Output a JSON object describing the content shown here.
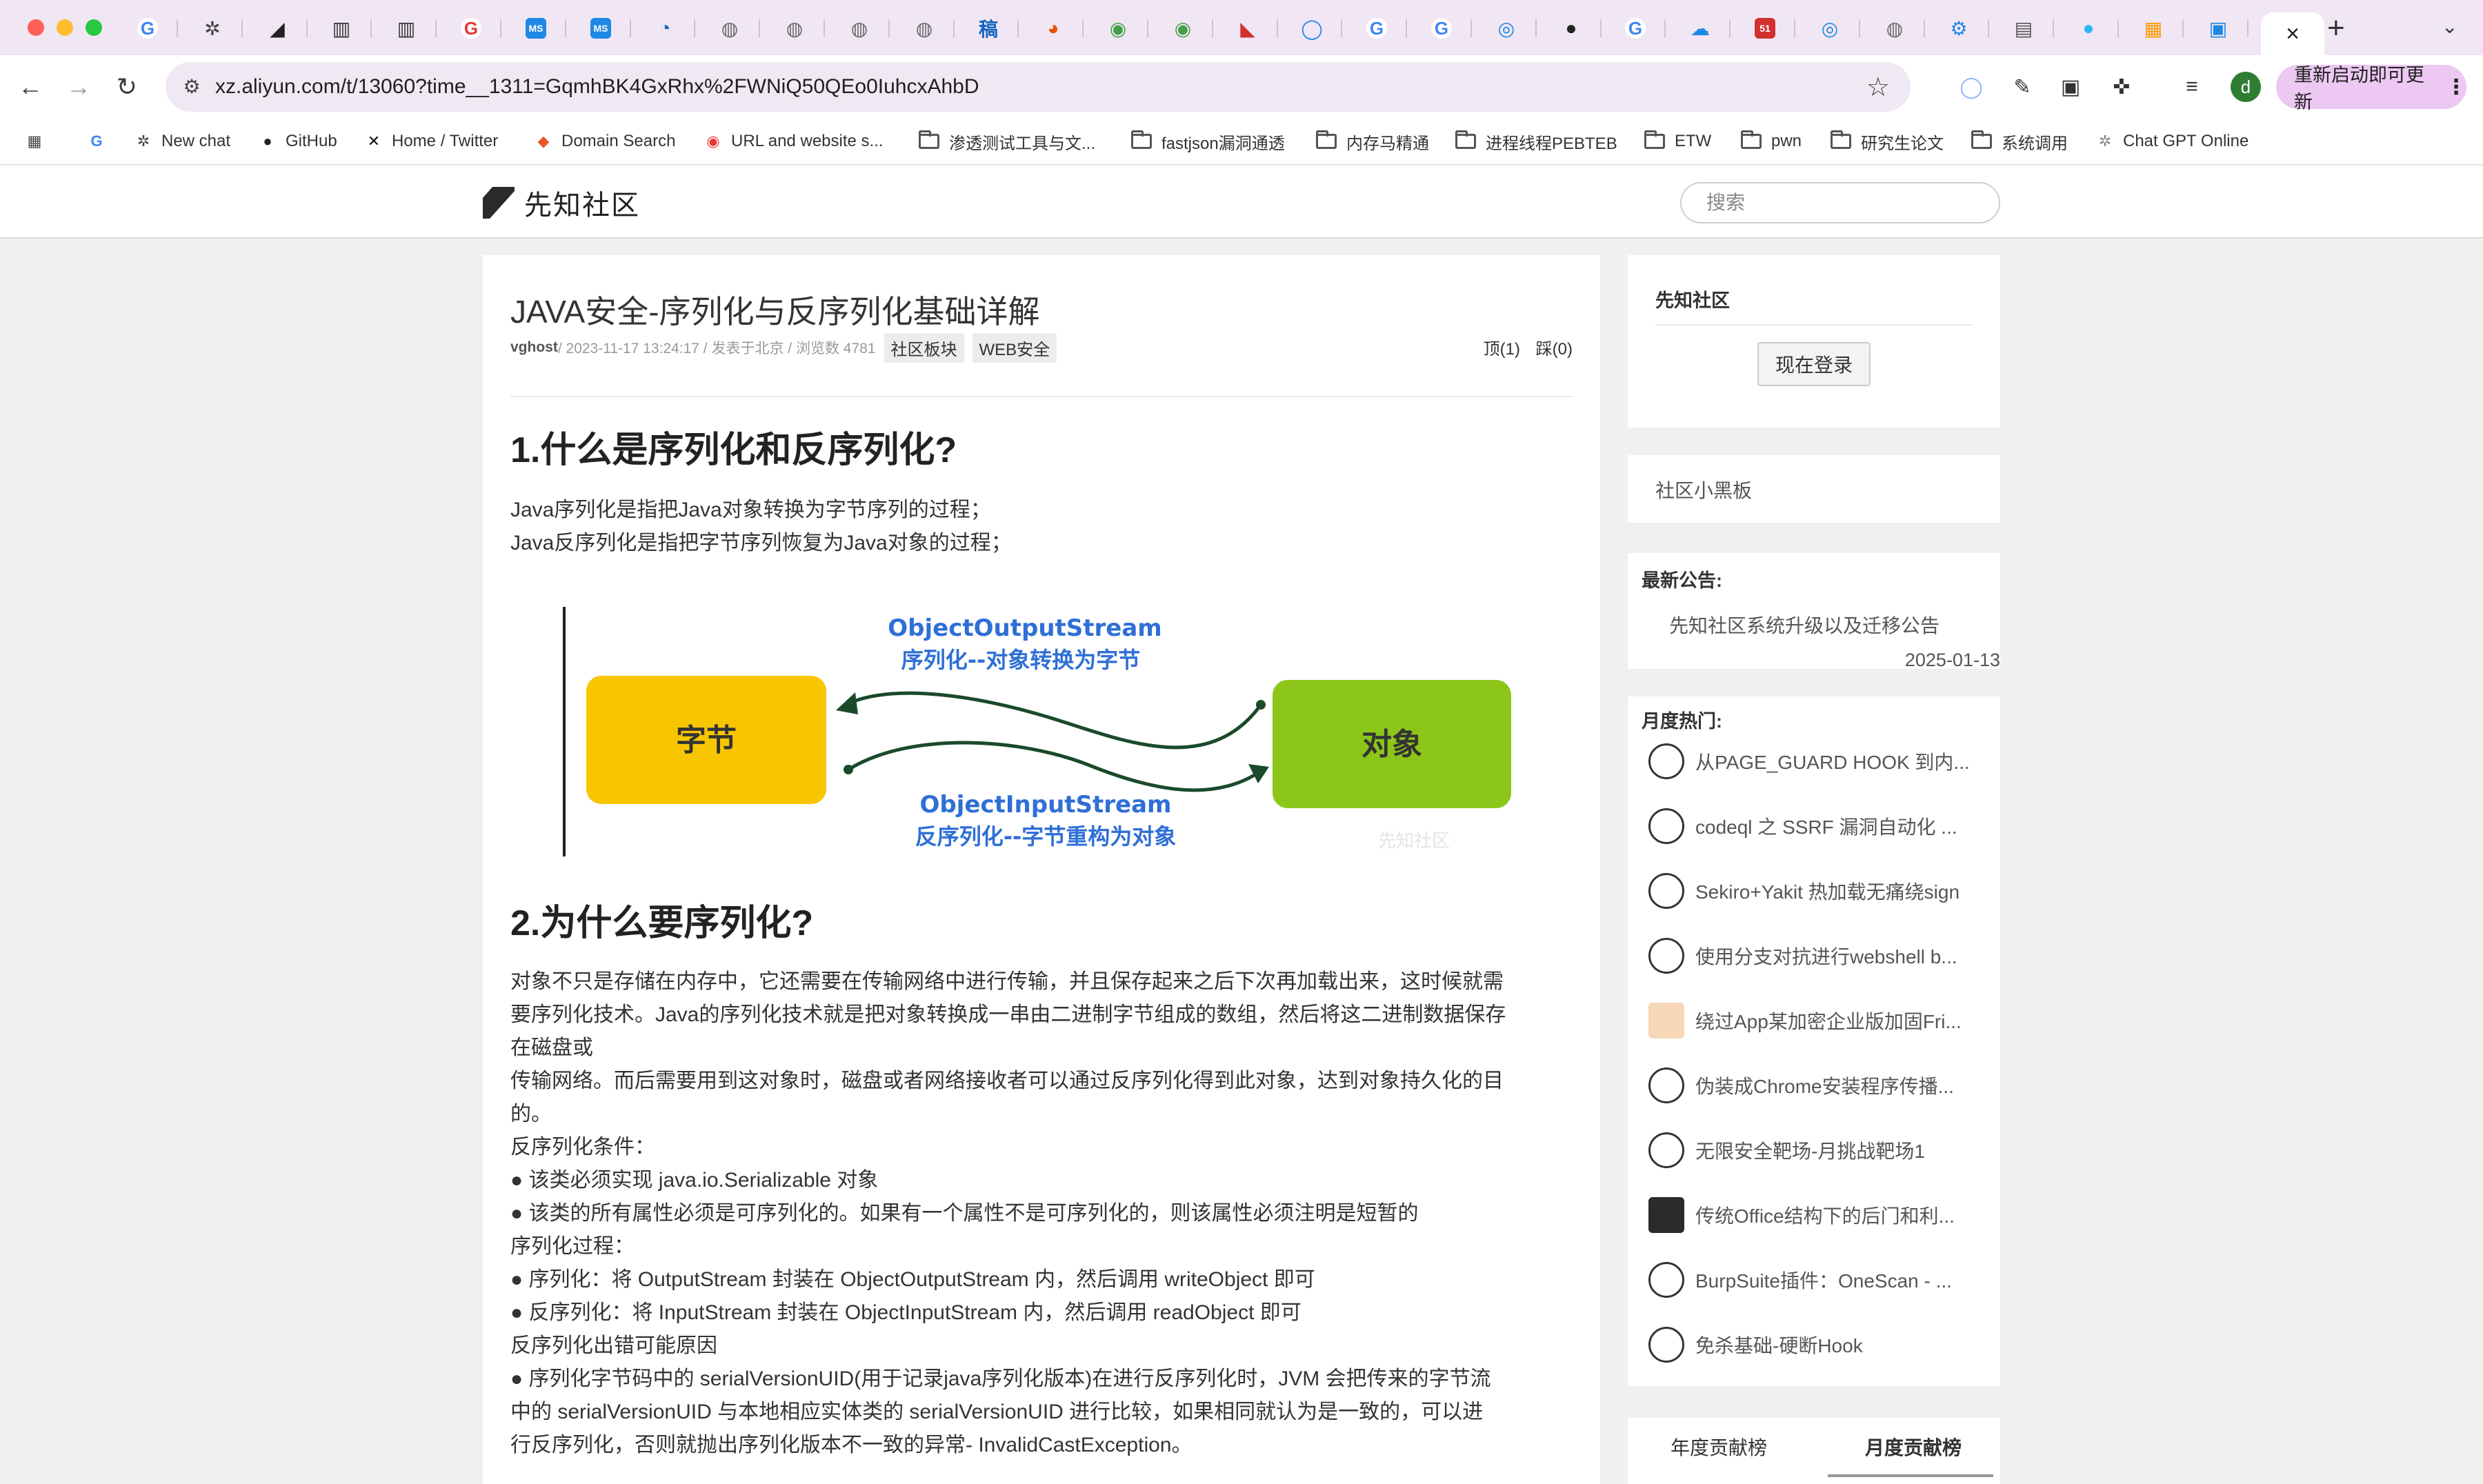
{
  "browser": {
    "tabs": [
      {
        "icon": "google-icon",
        "glyph": "G",
        "color": "#4285f4"
      },
      {
        "icon": "chatgpt-icon",
        "glyph": "✲",
        "color": "#444444"
      },
      {
        "icon": "xianzhi-icon",
        "glyph": "◢",
        "color": "#222222"
      },
      {
        "icon": "book-icon",
        "glyph": "▥",
        "color": "#333333"
      },
      {
        "icon": "book-icon",
        "glyph": "▥",
        "color": "#333333"
      },
      {
        "icon": "csdn-icon",
        "glyph": "G",
        "color": "#e53935"
      },
      {
        "icon": "msdn-icon",
        "glyph": "MS",
        "color": "#1e88e5"
      },
      {
        "icon": "msdn-icon",
        "glyph": "MS",
        "color": "#1e88e5"
      },
      {
        "icon": "search-icon",
        "glyph": "◔",
        "color": "#1565c0"
      },
      {
        "icon": "globe-icon",
        "glyph": "◍",
        "color": "#666666"
      },
      {
        "icon": "globe-icon",
        "glyph": "◍",
        "color": "#666666"
      },
      {
        "icon": "globe-icon",
        "glyph": "◍",
        "color": "#666666"
      },
      {
        "icon": "globe-icon",
        "glyph": "◍",
        "color": "#666666"
      },
      {
        "icon": "doc-icon",
        "glyph": "稿",
        "color": "#1565c0"
      },
      {
        "icon": "swirl-icon",
        "glyph": "◕",
        "color": "#e65100"
      },
      {
        "icon": "tools-icon",
        "glyph": "◉",
        "color": "#43a047"
      },
      {
        "icon": "tools-icon",
        "glyph": "◉",
        "color": "#43a047"
      },
      {
        "icon": "pdf-icon",
        "glyph": "◣",
        "color": "#d32f2f"
      },
      {
        "icon": "qq-icon",
        "glyph": "◯",
        "color": "#1e88e5"
      },
      {
        "icon": "google-icon",
        "glyph": "G",
        "color": "#4285f4"
      },
      {
        "icon": "google-icon",
        "glyph": "G",
        "color": "#4285f4"
      },
      {
        "icon": "blue-circle-icon",
        "glyph": "◎",
        "color": "#1e88e5"
      },
      {
        "icon": "github-icon",
        "glyph": "●",
        "color": "#222222"
      },
      {
        "icon": "google-icon",
        "glyph": "G",
        "color": "#4285f4"
      },
      {
        "icon": "cloud-icon",
        "glyph": "☁",
        "color": "#1e88e5"
      },
      {
        "icon": "51cto-icon",
        "glyph": "51",
        "color": "#d32f2f"
      },
      {
        "icon": "blue-circle-icon",
        "glyph": "◎",
        "color": "#1e88e5"
      },
      {
        "icon": "globe-icon",
        "glyph": "◍",
        "color": "#666666"
      },
      {
        "icon": "gear-icon",
        "glyph": "⚙",
        "color": "#1e88e5"
      },
      {
        "icon": "notes-icon",
        "glyph": "▤",
        "color": "#555555"
      },
      {
        "icon": "circle-icon",
        "glyph": "●",
        "color": "#29b6f6"
      },
      {
        "icon": "windows-icon",
        "glyph": "▦",
        "color": "#ff9800"
      },
      {
        "icon": "bilibili-icon",
        "glyph": "▣",
        "color": "#1e88e5"
      }
    ],
    "active_tab_close": "×",
    "new_tab": "+",
    "url": "xz.aliyun.com/t/13060?time__1311=GqmhBK4GxRhx%2FWNiQ50QEo0IuhcxAhbD",
    "update_button": "重新启动即可更新",
    "profile_initial": "d",
    "bookmarks": [
      {
        "label": "",
        "icon": "apps-grid-icon"
      },
      {
        "label": "",
        "icon": "google-icon"
      },
      {
        "label": "New chat",
        "icon": "chatgpt-icon"
      },
      {
        "label": "GitHub",
        "icon": "github-icon"
      },
      {
        "label": "Home / Twitter",
        "icon": "x-icon"
      },
      {
        "label": "Domain Search",
        "icon": "domain-icon"
      },
      {
        "label": "URL and website s...",
        "icon": "virustotal-icon"
      },
      {
        "label": "渗透测试工具与文...",
        "icon": "folder-icon"
      },
      {
        "label": "fastjson漏洞通透",
        "icon": "folder-icon"
      },
      {
        "label": "内存马精通",
        "icon": "folder-icon"
      },
      {
        "label": "进程线程PEBTEB",
        "icon": "folder-icon"
      },
      {
        "label": "ETW",
        "icon": "folder-icon"
      },
      {
        "label": "pwn",
        "icon": "folder-icon"
      },
      {
        "label": "研究生论文",
        "icon": "folder-icon"
      },
      {
        "label": "系统调用",
        "icon": "folder-icon"
      },
      {
        "label": "Chat GPT Online",
        "icon": "chatgpt-online-icon"
      }
    ]
  },
  "site": {
    "logo_text": "先知社区",
    "search_placeholder": "搜索"
  },
  "article": {
    "title": "JAVA安全-序列化与反序列化基础详解",
    "author": "vghost",
    "meta_rest": " / 2023-11-17 13:24:17 / 发表于北京 / 浏览数 4781",
    "tags": [
      "社区板块",
      "WEB安全"
    ],
    "upvote": "顶(1)",
    "downvote": "踩(0)",
    "h1": "1.什么是序列化和反序列化?",
    "intro": [
      "Java序列化是指把Java对象转换为字节序列的过程；",
      "Java反序列化是指把字节序列恢复为Java对象的过程；"
    ],
    "diagram": {
      "left_box": "字节",
      "right_box": "对象",
      "top_stream": "ObjectOutputStream",
      "top_desc": "序列化--对象转换为字节",
      "bottom_stream": "ObjectInputStream",
      "bottom_desc": "反序列化--字节重构为对象",
      "watermark": "先知社区"
    },
    "h2": "2.为什么要序列化?",
    "body": [
      "对象不只是存储在内存中，它还需要在传输网络中进行传输，并且保存起来之后下次再加载出来，这时候就需",
      "要序列化技术。Java的序列化技术就是把对象转换成一串由二进制字节组成的数组，然后将这二进制数据保存",
      "在磁盘或",
      "传输网络。而后需要用到这对象时，磁盘或者网络接收者可以通过反序列化得到此对象，达到对象持久化的目",
      "的。",
      "反序列化条件：",
      "● 该类必须实现 java.io.Serializable 对象",
      "● 该类的所有属性必须是可序列化的。如果有一个属性不是可序列化的，则该属性必须注明是短暂的",
      "序列化过程：",
      "● 序列化：将 OutputStream 封装在 ObjectOutputStream 内，然后调用 writeObject 即可",
      "● 反序列化：将 InputStream 封装在 ObjectInputStream 内，然后调用 readObject 即可",
      "反序列化出错可能原因",
      "● 序列化字节码中的 serialVersionUID(用于记录java序列化版本)在进行反序列化时，JVM 会把传来的字节流",
      "中的 serialVersionUID 与本地相应实体类的 serialVersionUID 进行比较，如果相同就认为是一致的，可以进",
      "行反序列化，否则就抛出序列化版本不一致的异常- InvalidCastException。"
    ]
  },
  "sidebar": {
    "login_card_title": "先知社区",
    "login_button": "现在登录",
    "board_title": "社区小黑板",
    "notice_title": "最新公告:",
    "notice_link": "先知社区系统升级以及迁移公告",
    "notice_date": "2025-01-13",
    "hot_title": "月度热门:",
    "hot_items": [
      "从PAGE_GUARD HOOK 到内...",
      "codeql 之 SSRF 漏洞自动化 ...",
      "Sekiro+Yakit 热加载无痛绕sign",
      "使用分支对抗进行webshell b...",
      "绕过App某加密企业版加固Fri...",
      "伪装成Chrome安装程序传播...",
      "无限安全靶场-月挑战靶场1",
      "传统Office结构下的后门和利...",
      "BurpSuite插件：OneScan - ...",
      "免杀基础-硬断Hook"
    ],
    "rank_tabs": [
      "年度贡献榜",
      "月度贡献榜"
    ]
  },
  "colors": {
    "bytes_box": "#f7c600",
    "object_box": "#8cc619",
    "stream_text": "#2f6fd6",
    "tabstrip_bg": "#f1e6f4",
    "update_btn": "#ecc8f2"
  }
}
